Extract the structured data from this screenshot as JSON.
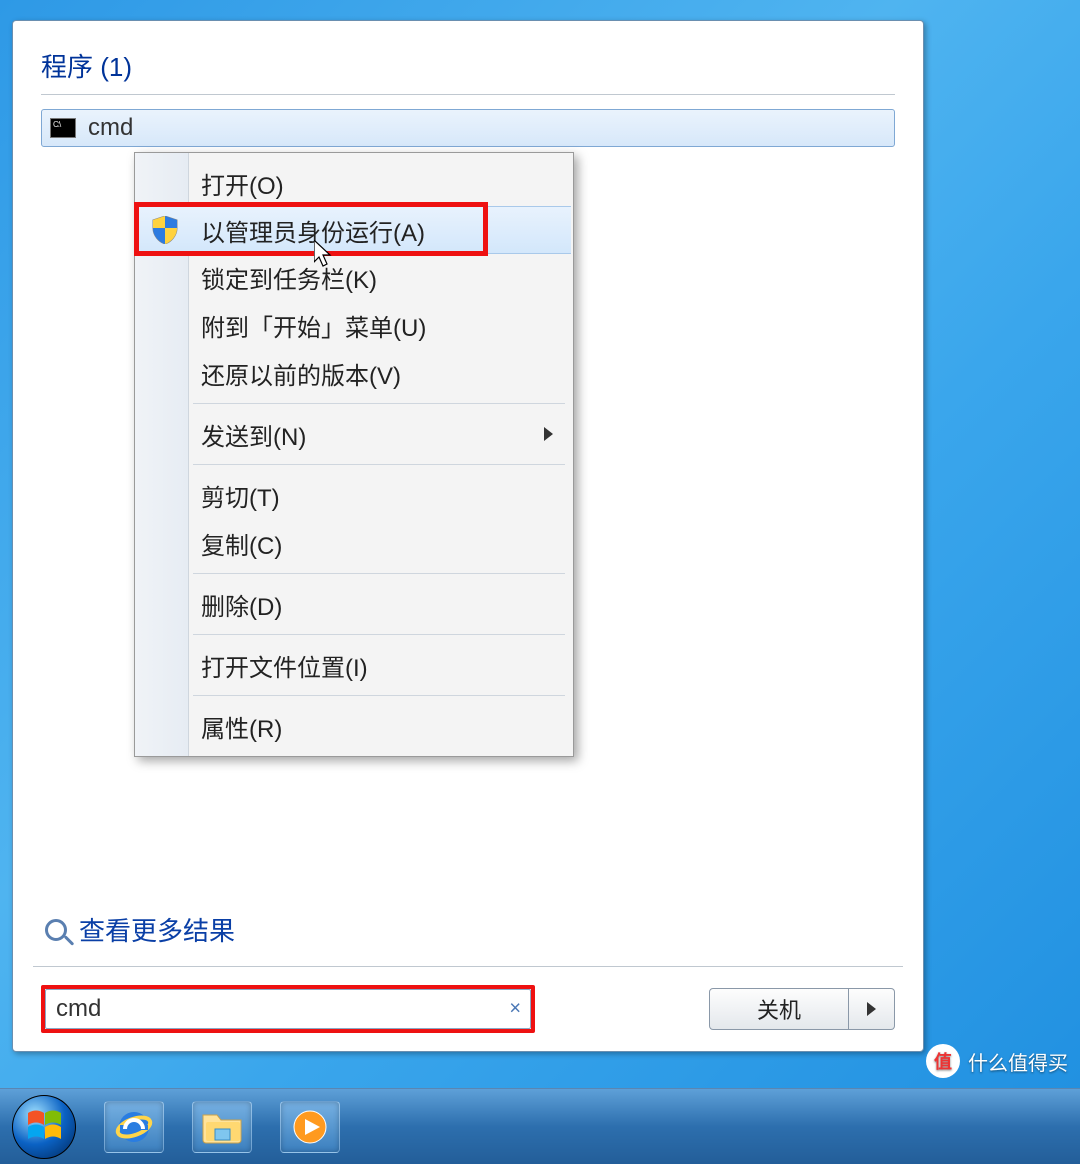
{
  "start_panel": {
    "section_header": "程序 (1)",
    "result_label": "cmd",
    "more_results": "查看更多结果",
    "search_value": "cmd",
    "shutdown_label": "关机"
  },
  "context_menu": {
    "items": [
      {
        "label": "打开(O)"
      },
      {
        "label": "以管理员身份运行(A)",
        "icon": "uac-shield",
        "highlighted": true
      },
      {
        "label": "锁定到任务栏(K)"
      },
      {
        "label": "附到「开始」菜单(U)"
      },
      {
        "label": "还原以前的版本(V)"
      },
      {
        "sep": true
      },
      {
        "label": "发送到(N)",
        "submenu": true
      },
      {
        "sep": true
      },
      {
        "label": "剪切(T)"
      },
      {
        "label": "复制(C)"
      },
      {
        "sep": true
      },
      {
        "label": "删除(D)"
      },
      {
        "sep": true
      },
      {
        "label": "打开文件位置(I)"
      },
      {
        "sep": true
      },
      {
        "label": "属性(R)"
      }
    ]
  },
  "watermark": {
    "badge": "值",
    "text": "什么值得买"
  }
}
